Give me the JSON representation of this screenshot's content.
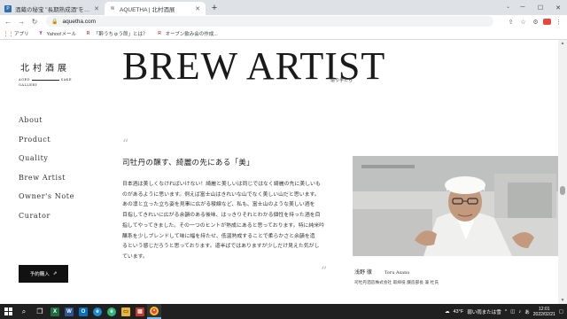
{
  "browser": {
    "tabs": [
      {
        "title": "酒蔵の秘宝 \"長期熟成酒\"を新酒市場から",
        "active": false,
        "favicon": "P"
      },
      {
        "title": "AQUETHA | 北村酒展",
        "active": true,
        "favicon": "AQ"
      }
    ],
    "new_tab_symbol": "+",
    "url": "aquetha.com",
    "bookmarks": [
      {
        "label": "アプリ",
        "icon": "apps-grid-icon"
      },
      {
        "label": "Yahoo!メール",
        "icon": "yahoo-icon"
      },
      {
        "label": "「酔うちゅう郎」とは？",
        "icon": "rakuten-icon"
      },
      {
        "label": "オーブン飲み会の作成...",
        "icon": "rakuten-icon"
      }
    ]
  },
  "site": {
    "logo": {
      "main": "北村酒展",
      "aged": "AGED",
      "sake": "SAKE",
      "gallery": "GALLERY"
    },
    "hero_title": "BREW ARTIST",
    "hero_subtitle": "造り手たち",
    "nav": [
      "About",
      "Product",
      "Quality",
      "Brew Artist",
      "Owner's Note",
      "Curator"
    ],
    "buy_button": {
      "label": "予約購入",
      "icon": "external-link-icon"
    },
    "article": {
      "quote_open": "“",
      "quote_close": "”",
      "headline": "司牡丹の醸す、綺麗の先にある「美」",
      "body_lines": [
        "日本酒は美しくなければいけない！綺麗と美しいは同じではなく綺麗の先に美しいも",
        "のがあるように思います。例えば富士山はきれいな山でなく美しい山だと思います。",
        "あの凛と立った立ち姿を見事に広がる稜線など、私も、富士山のような美しい酒を",
        "目指してきれいに広がる余韻のある後味、はっきりそれとわかる個性を持った酒を目",
        "指してやってきました。その一つのヒントが熟成にあると思っております。特に純米吟",
        "醸系を少しブレンドして味に幅を持たせ、低温熟成することで柔らかさと余韻を造",
        "るという感じだろうと思っております。道半ばではありますが少しだけ見えた気がし",
        "ています。"
      ],
      "author_name": "浅野 徹",
      "author_romaji": "Toru Asano",
      "author_role": "司牡丹酒造株式会社 取締役 醸造部長 兼 杜氏"
    }
  },
  "taskbar": {
    "weather": "43°F",
    "weather_text": "弱い雨または雪",
    "ime": "あ",
    "time": "12:01",
    "date": "2022/02/21"
  }
}
